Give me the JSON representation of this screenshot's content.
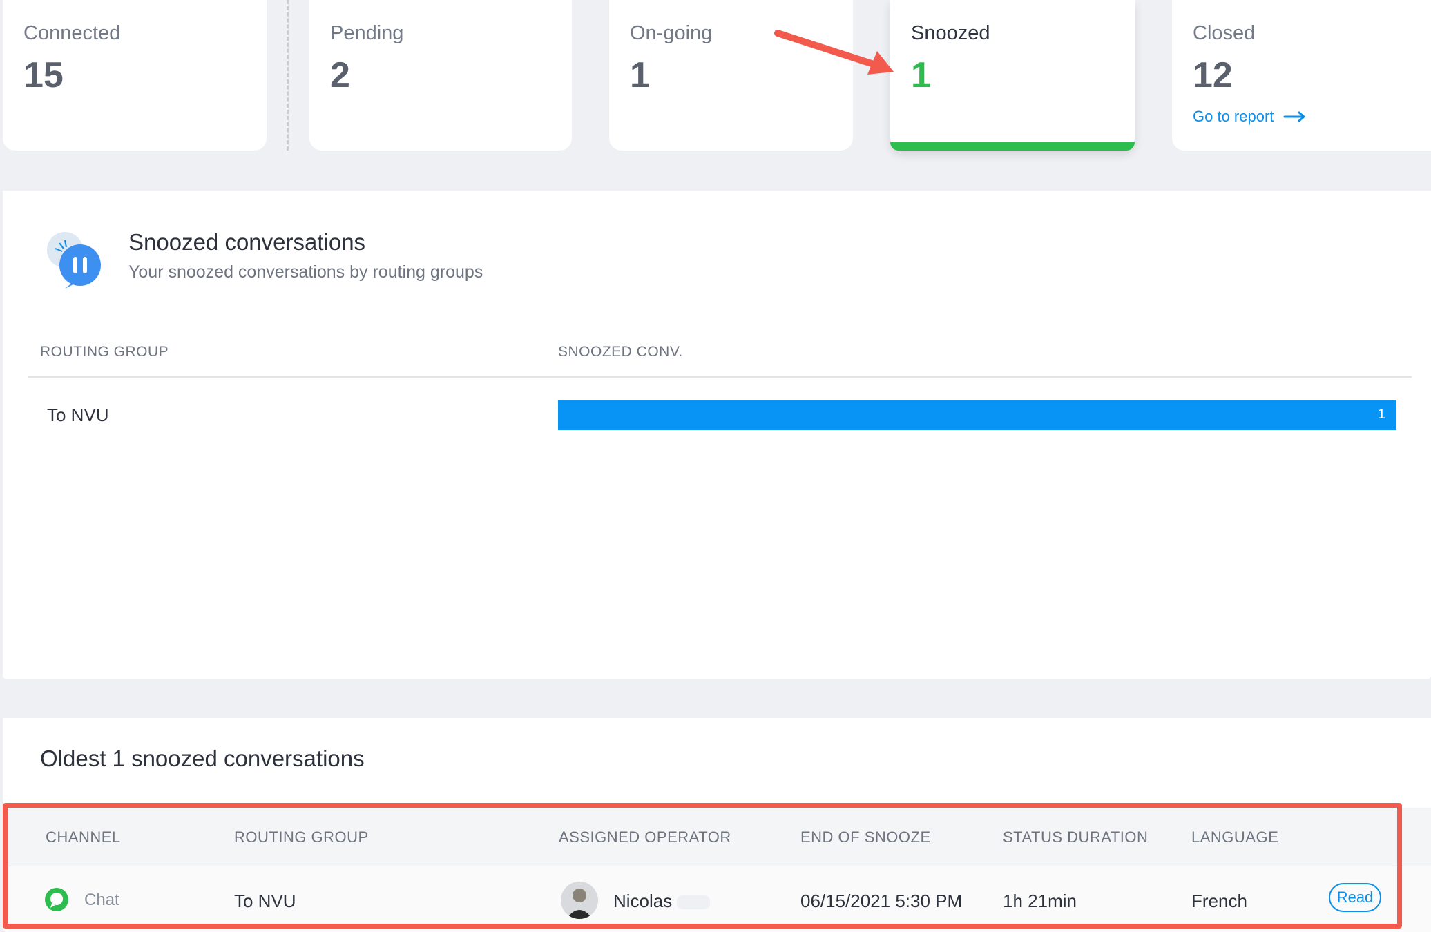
{
  "stats": [
    {
      "label": "Connected",
      "value": "15"
    },
    {
      "label": "Pending",
      "value": "2"
    },
    {
      "label": "On-going",
      "value": "1"
    },
    {
      "label": "Snoozed",
      "value": "1"
    },
    {
      "label": "Closed",
      "value": "12",
      "link": "Go to report"
    }
  ],
  "snoozed_panel": {
    "title": "Snoozed conversations",
    "subtitle": "Your snoozed conversations by routing groups",
    "col_routing": "ROUTING GROUP",
    "col_snoozed": "SNOOZED CONV.",
    "rows": [
      {
        "group": "To NVU",
        "count": "1",
        "fill_fraction": 1.0
      }
    ]
  },
  "oldest_panel": {
    "title": "Oldest 1 snoozed conversations",
    "headers": [
      "CHANNEL",
      "ROUTING GROUP",
      "ASSIGNED OPERATOR",
      "END OF SNOOZE",
      "STATUS DURATION",
      "LANGUAGE"
    ],
    "row": {
      "channel": "Chat",
      "routing_group": "To NVU",
      "operator": "Nicolas",
      "end_of_snooze": "06/15/2021 5:30 PM",
      "status_duration": "1h 21min",
      "language": "French",
      "action": "Read"
    }
  },
  "colors": {
    "accent_green": "#2dbd4e",
    "bar_blue": "#0894f4",
    "link_blue": "#0b8fe9",
    "annotation_red": "#f25a4d"
  }
}
